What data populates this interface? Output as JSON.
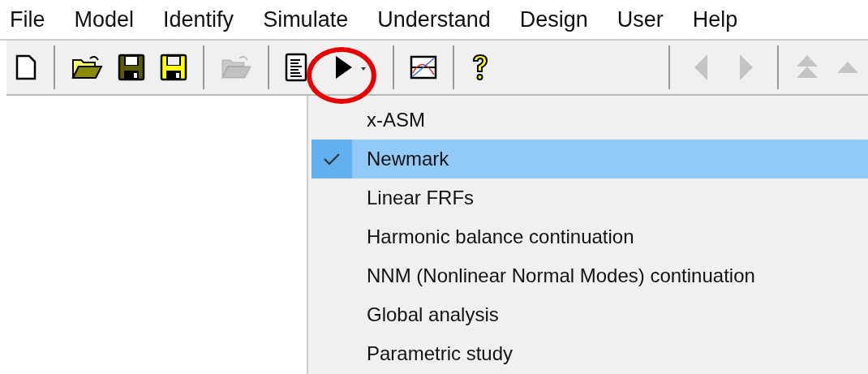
{
  "menubar": [
    {
      "label": "File"
    },
    {
      "label": "Model"
    },
    {
      "label": "Identify"
    },
    {
      "label": "Simulate"
    },
    {
      "label": "Understand"
    },
    {
      "label": "Design"
    },
    {
      "label": "User"
    },
    {
      "label": "Help"
    }
  ],
  "toolbar": [
    {
      "kind": "new",
      "disabled": false,
      "highlighted": false
    },
    {
      "kind": "separator"
    },
    {
      "kind": "open",
      "disabled": false,
      "highlighted": false
    },
    {
      "kind": "save",
      "disabled": false,
      "highlighted": false
    },
    {
      "kind": "saveas",
      "disabled": false,
      "highlighted": false
    },
    {
      "kind": "separator"
    },
    {
      "kind": "open",
      "disabled": true,
      "highlighted": false
    },
    {
      "kind": "separator"
    },
    {
      "kind": "report",
      "disabled": false,
      "highlighted": false
    },
    {
      "kind": "run",
      "disabled": false,
      "highlighted": true
    },
    {
      "kind": "separator"
    },
    {
      "kind": "plot",
      "disabled": false,
      "highlighted": false
    },
    {
      "kind": "separator"
    },
    {
      "kind": "help",
      "disabled": false,
      "highlighted": false
    },
    {
      "kind": "spacer"
    },
    {
      "kind": "separator"
    },
    {
      "kind": "back",
      "disabled": true,
      "highlighted": false
    },
    {
      "kind": "forward",
      "disabled": true,
      "highlighted": false
    },
    {
      "kind": "separator"
    },
    {
      "kind": "top",
      "disabled": true,
      "highlighted": false
    },
    {
      "kind": "up",
      "disabled": true,
      "highlighted": false
    }
  ],
  "dropdown": [
    {
      "label": "x-ASM",
      "checked": false,
      "selected": false
    },
    {
      "label": "Newmark",
      "checked": true,
      "selected": true
    },
    {
      "label": "Linear FRFs",
      "checked": false,
      "selected": false
    },
    {
      "label": "Harmonic balance continuation",
      "checked": false,
      "selected": false
    },
    {
      "label": "NNM (Nonlinear Normal Modes) continuation",
      "checked": false,
      "selected": false
    },
    {
      "label": "Global analysis",
      "checked": false,
      "selected": false
    },
    {
      "label": "Parametric study",
      "checked": false,
      "selected": false
    }
  ]
}
